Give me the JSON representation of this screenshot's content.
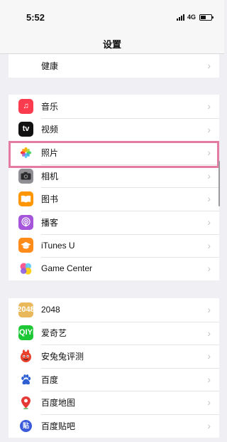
{
  "status_bar": {
    "time": "5:52",
    "network": "4G"
  },
  "nav": {
    "title": "设置"
  },
  "sections": [
    {
      "items": [
        {
          "label": "健康",
          "icon": "heart-icon"
        }
      ]
    },
    {
      "items": [
        {
          "label": "音乐",
          "icon": "music-icon"
        },
        {
          "label": "视频",
          "icon": "apple-tv-icon",
          "icon_text": "tv"
        },
        {
          "label": "照片",
          "icon": "photos-icon"
        },
        {
          "label": "相机",
          "icon": "camera-icon"
        },
        {
          "label": "图书",
          "icon": "books-icon"
        },
        {
          "label": "播客",
          "icon": "podcasts-icon"
        },
        {
          "label": "iTunes U",
          "icon": "itunes-u-icon"
        },
        {
          "label": "Game Center",
          "icon": "game-center-icon"
        }
      ]
    },
    {
      "items": [
        {
          "label": "2048",
          "icon": "app-2048-icon",
          "icon_text": "2048"
        },
        {
          "label": "爱奇艺",
          "icon": "iqiyi-icon",
          "icon_text": "iQIYI"
        },
        {
          "label": "安兔兔评测",
          "icon": "antutu-icon"
        },
        {
          "label": "百度",
          "icon": "baidu-paw-icon"
        },
        {
          "label": "百度地图",
          "icon": "baidu-map-pin-icon"
        },
        {
          "label": "百度贴吧",
          "icon": "baidu-tieba-icon",
          "icon_text": "贴"
        }
      ]
    }
  ],
  "colors": {
    "highlight": "#e37ba3",
    "background": "#efeff4",
    "chevron": "#c4c4c9"
  }
}
